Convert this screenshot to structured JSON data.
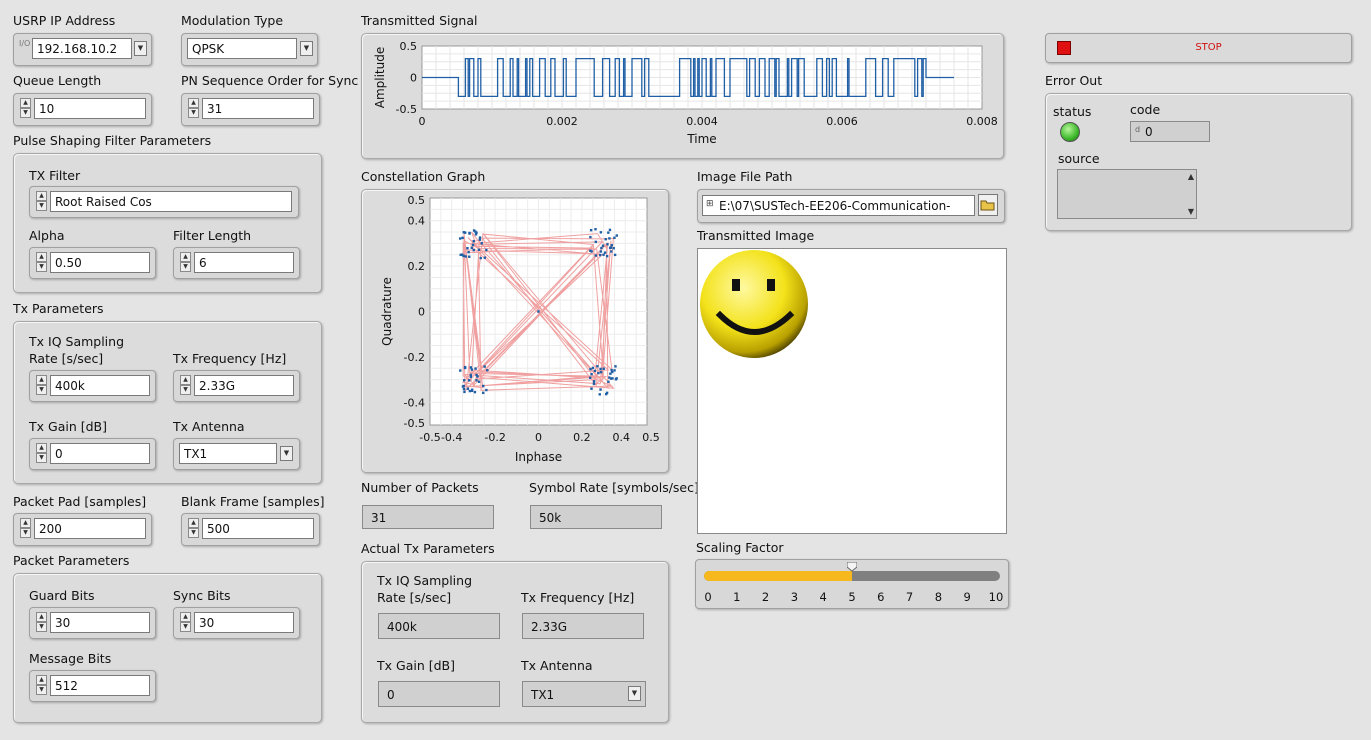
{
  "controls": {
    "usrp_ip": {
      "label": "USRP IP Address",
      "value": "192.168.10.2"
    },
    "modulation": {
      "label": "Modulation Type",
      "value": "QPSK"
    },
    "queue_length": {
      "label": "Queue Length",
      "value": "10"
    },
    "pn_order": {
      "label": "PN Sequence Order for Sync",
      "value": "31"
    },
    "pulse_shaping": {
      "title": "Pulse Shaping Filter Parameters",
      "tx_filter": {
        "label": "TX Filter",
        "value": "Root Raised Cos"
      },
      "alpha": {
        "label": "Alpha",
        "value": "0.50"
      },
      "filter_length": {
        "label": "Filter Length",
        "value": "6"
      }
    },
    "tx_params": {
      "title": "Tx Parameters",
      "iq_rate": {
        "label_line1": "Tx IQ Sampling",
        "label_line2": "Rate [s/sec]",
        "value": "400k"
      },
      "tx_freq": {
        "label": "Tx Frequency [Hz]",
        "value": "2.33G"
      },
      "tx_gain": {
        "label": "Tx Gain [dB]",
        "value": "0"
      },
      "tx_antenna": {
        "label": "Tx Antenna",
        "value": "TX1"
      }
    },
    "packet_pad": {
      "label": "Packet Pad [samples]",
      "value": "200"
    },
    "blank_frame": {
      "label": "Blank Frame [samples]",
      "value": "500"
    },
    "packet_params": {
      "title": "Packet Parameters",
      "guard_bits": {
        "label": "Guard Bits",
        "value": "30"
      },
      "sync_bits": {
        "label": "Sync Bits",
        "value": "30"
      },
      "message_bits": {
        "label": "Message Bits",
        "value": "512"
      }
    }
  },
  "transmitted_signal": {
    "title": "Transmitted Signal",
    "chart_data": {
      "type": "line",
      "xlabel": "Time",
      "ylabel": "Amplitude",
      "xlim": [
        0,
        0.008
      ],
      "ylim": [
        -0.5,
        0.5
      ],
      "xticks": [
        "0",
        "0.002",
        "0.004",
        "0.006",
        "0.008"
      ],
      "yticks": [
        "0.5",
        "0",
        "-0.5"
      ],
      "series": [
        {
          "color": "#1f5fa6",
          "description": "burst of +/-0.3 symbols between 0.00062 and 0.0072, zero elsewhere"
        }
      ],
      "burst_start": 0.00062,
      "burst_end": 0.0072,
      "amplitude": 0.3,
      "end_time": 0.0076
    }
  },
  "constellation": {
    "title": "Constellation Graph",
    "chart_data": {
      "type": "scatter",
      "xlabel": "Inphase",
      "ylabel": "Quadrature",
      "xlim": [
        -0.5,
        0.5
      ],
      "ylim": [
        -0.5,
        0.5
      ],
      "xticks": [
        "-0.5",
        "-0.4",
        "-0.2",
        "0",
        "0.2",
        "0.4",
        "0.5"
      ],
      "yticks": [
        "0.5",
        "0.4",
        "0.2",
        "0",
        "-0.2",
        "-0.4",
        "-0.5"
      ],
      "clusters": [
        [
          -0.3,
          0.3
        ],
        [
          0.3,
          0.3
        ],
        [
          -0.3,
          -0.3
        ],
        [
          0.3,
          -0.3
        ]
      ],
      "point_color": "#1f5fa6",
      "trace_color": "#f0a0a0"
    }
  },
  "number_of_packets": {
    "label": "Number of Packets",
    "value": "31"
  },
  "symbol_rate": {
    "label": "Symbol Rate [symbols/sec]",
    "value": "50k"
  },
  "actual_tx": {
    "title": "Actual Tx Parameters",
    "iq_rate": {
      "label_line1": "Tx IQ Sampling",
      "label_line2": "Rate [s/sec]",
      "value": "400k"
    },
    "tx_freq": {
      "label": "Tx Frequency [Hz]",
      "value": "2.33G"
    },
    "tx_gain": {
      "label": "Tx Gain [dB]",
      "value": "0"
    },
    "tx_antenna": {
      "label": "Tx Antenna",
      "value": "TX1"
    }
  },
  "image_file": {
    "label": "Image File Path",
    "value": "E:\\07\\SUSTech-EE206-Communication-"
  },
  "transmitted_image": {
    "label": "Transmitted Image"
  },
  "scaling": {
    "label": "Scaling Factor",
    "value": 5,
    "min": 0,
    "max": 10,
    "ticks": [
      "0",
      "1",
      "2",
      "3",
      "4",
      "5",
      "6",
      "7",
      "8",
      "9",
      "10"
    ],
    "fill_color": "#f6b81c"
  },
  "stop": {
    "label": "STOP",
    "color": "#e01010"
  },
  "error_out": {
    "title": "Error Out",
    "status_label": "status",
    "code_label": "code",
    "code_value": "0",
    "source_label": "source",
    "status_color": "#3cb82a"
  }
}
